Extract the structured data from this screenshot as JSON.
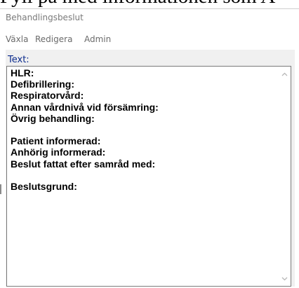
{
  "banner": {
    "text": "Fyll på med informationen som A"
  },
  "window": {
    "title": "Behandlingsbeslut"
  },
  "menu": {
    "items": [
      {
        "label": "Växla"
      },
      {
        "label": "Redigera"
      },
      {
        "label": "Admin"
      }
    ]
  },
  "field": {
    "label": "Text:",
    "lines": [
      "HLR:",
      "Defibrillering:",
      "Respiratorvård:",
      "Annan vårdnivå vid försämring:",
      "Övrig behandling:",
      "",
      "Patient informerad:",
      "Anhörig informerad:",
      "Beslut fattat efter samråd med:",
      "",
      "Beslutsgrund:"
    ]
  },
  "icons": {
    "scroll_up": "chevron-up-icon",
    "scroll_down": "chevron-down-icon"
  },
  "colors": {
    "label_blue": "#0a2a8c",
    "menu_gray": "#6b6b6b",
    "panel_bg": "#f0f0f0"
  }
}
